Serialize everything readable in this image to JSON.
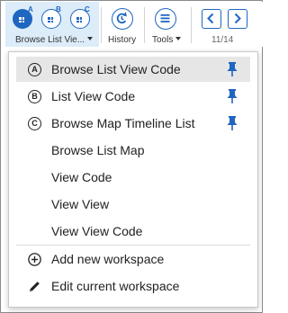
{
  "toolbar": {
    "workspace_label": "Browse List Vie...",
    "history_label": "History",
    "tools_label": "Tools",
    "page_indicator": "11/14",
    "ws_letters": [
      "A",
      "B",
      "C"
    ]
  },
  "menu": {
    "pinned_items": [
      {
        "letter": "A",
        "label": "Browse List View Code",
        "selected": true
      },
      {
        "letter": "B",
        "label": "List View Code",
        "selected": false
      },
      {
        "letter": "C",
        "label": "Browse Map Timeline List",
        "selected": false
      }
    ],
    "items": [
      {
        "label": "Browse List Map"
      },
      {
        "label": "View Code"
      },
      {
        "label": "View View"
      },
      {
        "label": "View View Code"
      }
    ],
    "actions": [
      {
        "icon": "plus-circle-icon",
        "label": "Add new workspace"
      },
      {
        "icon": "pencil-icon",
        "label": "Edit current workspace"
      }
    ]
  },
  "colors": {
    "accent": "#1f66c1",
    "selected_bg": "#e6e6e6",
    "active_group_bg": "#dcecf9"
  }
}
